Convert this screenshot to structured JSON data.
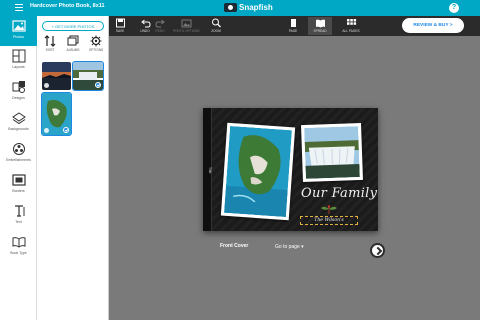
{
  "topbar": {
    "project_title": "Hardcover Photo Book, 8x11",
    "logo_text": "Snapfish",
    "help_label": "?"
  },
  "rail": {
    "items": [
      {
        "label": "Photos",
        "icon": "photos-icon",
        "active": true
      },
      {
        "label": "Layouts",
        "icon": "layouts-icon"
      },
      {
        "label": "Designs",
        "icon": "designs-icon"
      },
      {
        "label": "Backgrounds",
        "icon": "backgrounds-icon"
      },
      {
        "label": "Embellishments",
        "icon": "embellishments-icon"
      },
      {
        "label": "Borders",
        "icon": "borders-icon"
      },
      {
        "label": "Text",
        "icon": "text-icon"
      },
      {
        "label": "Book Type",
        "icon": "book-type-icon"
      }
    ]
  },
  "panel": {
    "get_more": "+ GET MORE PHOTOS",
    "tools": [
      {
        "label": "SORT",
        "icon": "sort-icon"
      },
      {
        "label": "ALBUMS",
        "icon": "albums-icon"
      },
      {
        "label": "OPTIONS",
        "icon": "gear-icon"
      }
    ]
  },
  "toolbar": {
    "save": "SAVE",
    "undo": "UNDO",
    "redo": "REDO",
    "photo_options": "PHOTO OPTIONS",
    "zoom": "ZOOM",
    "page": "PAGE",
    "spread": "SPREAD",
    "all_pages": "ALL PAGES",
    "review_buy": "REVIEW & BUY >"
  },
  "book": {
    "spine_title": "Title",
    "cover_title": "Our Family",
    "name_label": "The Wilson's"
  },
  "nav": {
    "front_cover": "Front Cover",
    "go_to_page": "Go to page ▾"
  },
  "colors": {
    "brand": "#00a8c6",
    "toolbar": "#2b2b2b",
    "canvas": "#7a7a7a",
    "accent_blue": "#1e88e5"
  }
}
